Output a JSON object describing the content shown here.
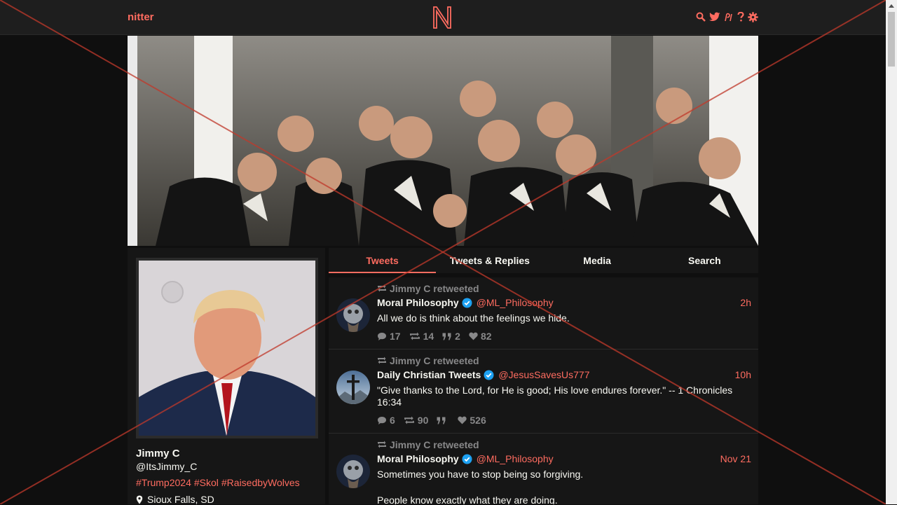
{
  "navbar": {
    "brand": "nitter",
    "logo_letter": "N",
    "icons": [
      "search-icon",
      "twitter-bird-icon",
      "rss-icon",
      "help-icon",
      "settings-icon"
    ]
  },
  "profile": {
    "fullname": "Jimmy C",
    "username": "@ItsJimmy_C",
    "bio_tags": [
      "#Trump2024",
      "#Skol",
      "#RaisedbyWolves"
    ],
    "location": "Sioux Falls, SD"
  },
  "tabs": [
    {
      "label": "Tweets",
      "active": true
    },
    {
      "label": "Tweets & Replies",
      "active": false
    },
    {
      "label": "Media",
      "active": false
    },
    {
      "label": "Search",
      "active": false
    }
  ],
  "tweets": [
    {
      "retweet_header": "Jimmy C retweeted",
      "fullname": "Moral Philosophy",
      "username": "@ML_Philosophy",
      "date": "2h",
      "content": "All we do is think about the feelings we hide.",
      "replies": "17",
      "retweets": "14",
      "quotes": "2",
      "likes": "82"
    },
    {
      "retweet_header": "Jimmy C retweeted",
      "fullname": "Daily Christian Tweets",
      "username": "@JesusSavesUs777",
      "date": "10h",
      "content": "\"Give thanks to the Lord, for He is good; His love endures forever.\" -- 1 Chronicles 16:34",
      "replies": "6",
      "retweets": "90",
      "quotes": "",
      "likes": "526"
    },
    {
      "retweet_header": "Jimmy C retweeted",
      "fullname": "Moral Philosophy",
      "username": "@ML_Philosophy",
      "date": "Nov 21",
      "content": "Sometimes you have to stop being so forgiving.",
      "content_2": "People know exactly what they are doing."
    }
  ],
  "colors": {
    "accent": "#ff6c60",
    "background": "#0f0f0f",
    "panel": "#161616",
    "navbar": "#1e1e1e",
    "muted": "#888889",
    "verified": "#1da1f2",
    "overlay_cross": "#c0392b"
  }
}
